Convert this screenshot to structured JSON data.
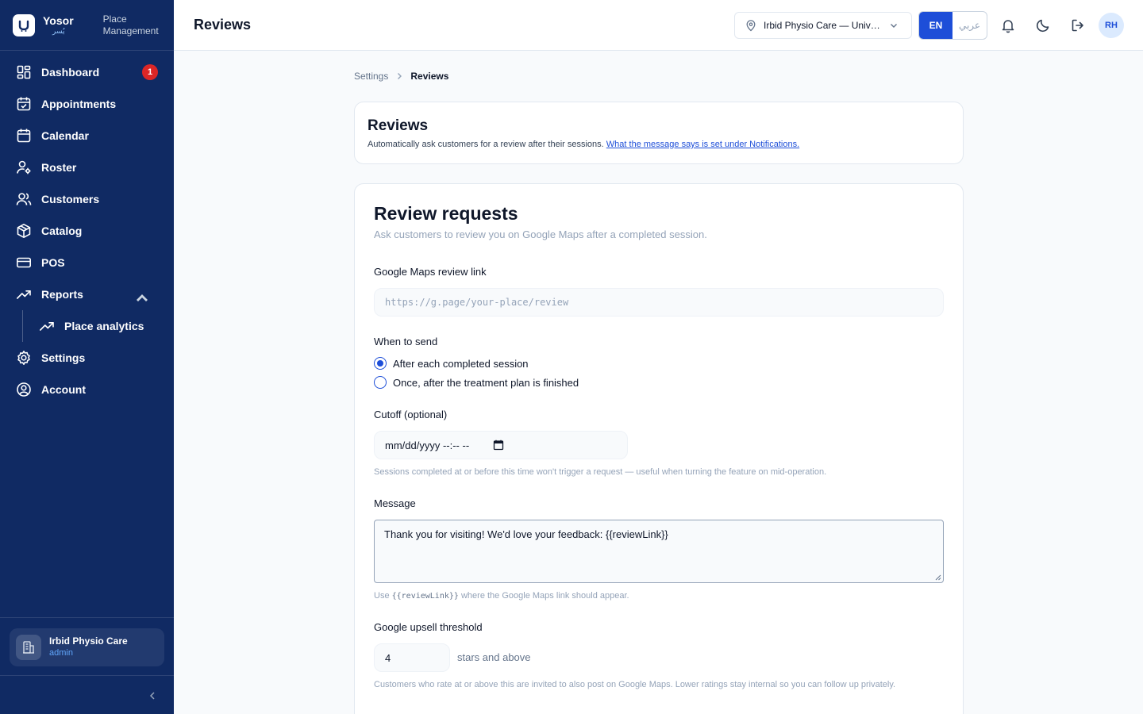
{
  "brand": {
    "name": "Yosor",
    "name_ar": "يُسر",
    "subtitle_line1": "Place",
    "subtitle_line2": "Management"
  },
  "sidebar": {
    "items": [
      {
        "label": "Dashboard",
        "icon": "dashboard-icon",
        "badge": "1"
      },
      {
        "label": "Appointments",
        "icon": "calendar-check-icon"
      },
      {
        "label": "Calendar",
        "icon": "calendar-icon"
      },
      {
        "label": "Roster",
        "icon": "user-cog-icon"
      },
      {
        "label": "Customers",
        "icon": "users-icon"
      },
      {
        "label": "Catalog",
        "icon": "package-icon"
      },
      {
        "label": "POS",
        "icon": "credit-card-icon"
      },
      {
        "label": "Reports",
        "icon": "trending-up-icon",
        "expanded": true
      },
      {
        "label": "Place analytics",
        "icon": "trending-up-icon",
        "sub": true
      },
      {
        "label": "Settings",
        "icon": "gear-icon"
      },
      {
        "label": "Account",
        "icon": "user-circle-icon"
      }
    ],
    "footer": {
      "place_name": "Irbid Physio Care",
      "role": "admin"
    }
  },
  "header": {
    "title": "Reviews",
    "place_selector": "Irbid Physio Care — University Street",
    "lang_en": "EN",
    "lang_ar": "عربي",
    "avatar_initials": "RH"
  },
  "breadcrumb": {
    "parent": "Settings",
    "current": "Reviews"
  },
  "intro": {
    "title": "Reviews",
    "description": "Automatically ask customers for a review after their sessions.",
    "link": "What the message says is set under Notifications."
  },
  "review_requests": {
    "title": "Review requests",
    "subtitle": "Ask customers to review you on Google Maps after a completed session.",
    "link_label": "Google Maps review link",
    "link_placeholder": "https://g.page/your-place/review",
    "when_label": "When to send",
    "options": [
      {
        "label": "After each completed session",
        "selected": true
      },
      {
        "label": "Once, after the treatment plan is finished",
        "selected": false
      }
    ],
    "cutoff_label": "Cutoff (optional)",
    "cutoff_placeholder": "mm/dd/yyyy --:-- --",
    "cutoff_help": "Sessions completed at or before this time won't trigger a request — useful when turning the feature on mid-operation.",
    "message_label": "Message",
    "message_value": "Thank you for visiting! We'd love your feedback: {{reviewLink}}",
    "message_help_prefix": "Use",
    "message_help_code": "{{reviewLink}}",
    "message_help_suffix": "where the Google Maps link should appear.",
    "threshold_label": "Google upsell threshold",
    "threshold_value": "4",
    "threshold_suffix": "stars and above",
    "threshold_help": "Customers who rate at or above this are invited to also post on Google Maps. Lower ratings stay internal so you can follow up privately."
  },
  "colors": {
    "sidebar_bg": "#102a63",
    "accent": "#1d4ed8",
    "badge": "#dc2626"
  }
}
